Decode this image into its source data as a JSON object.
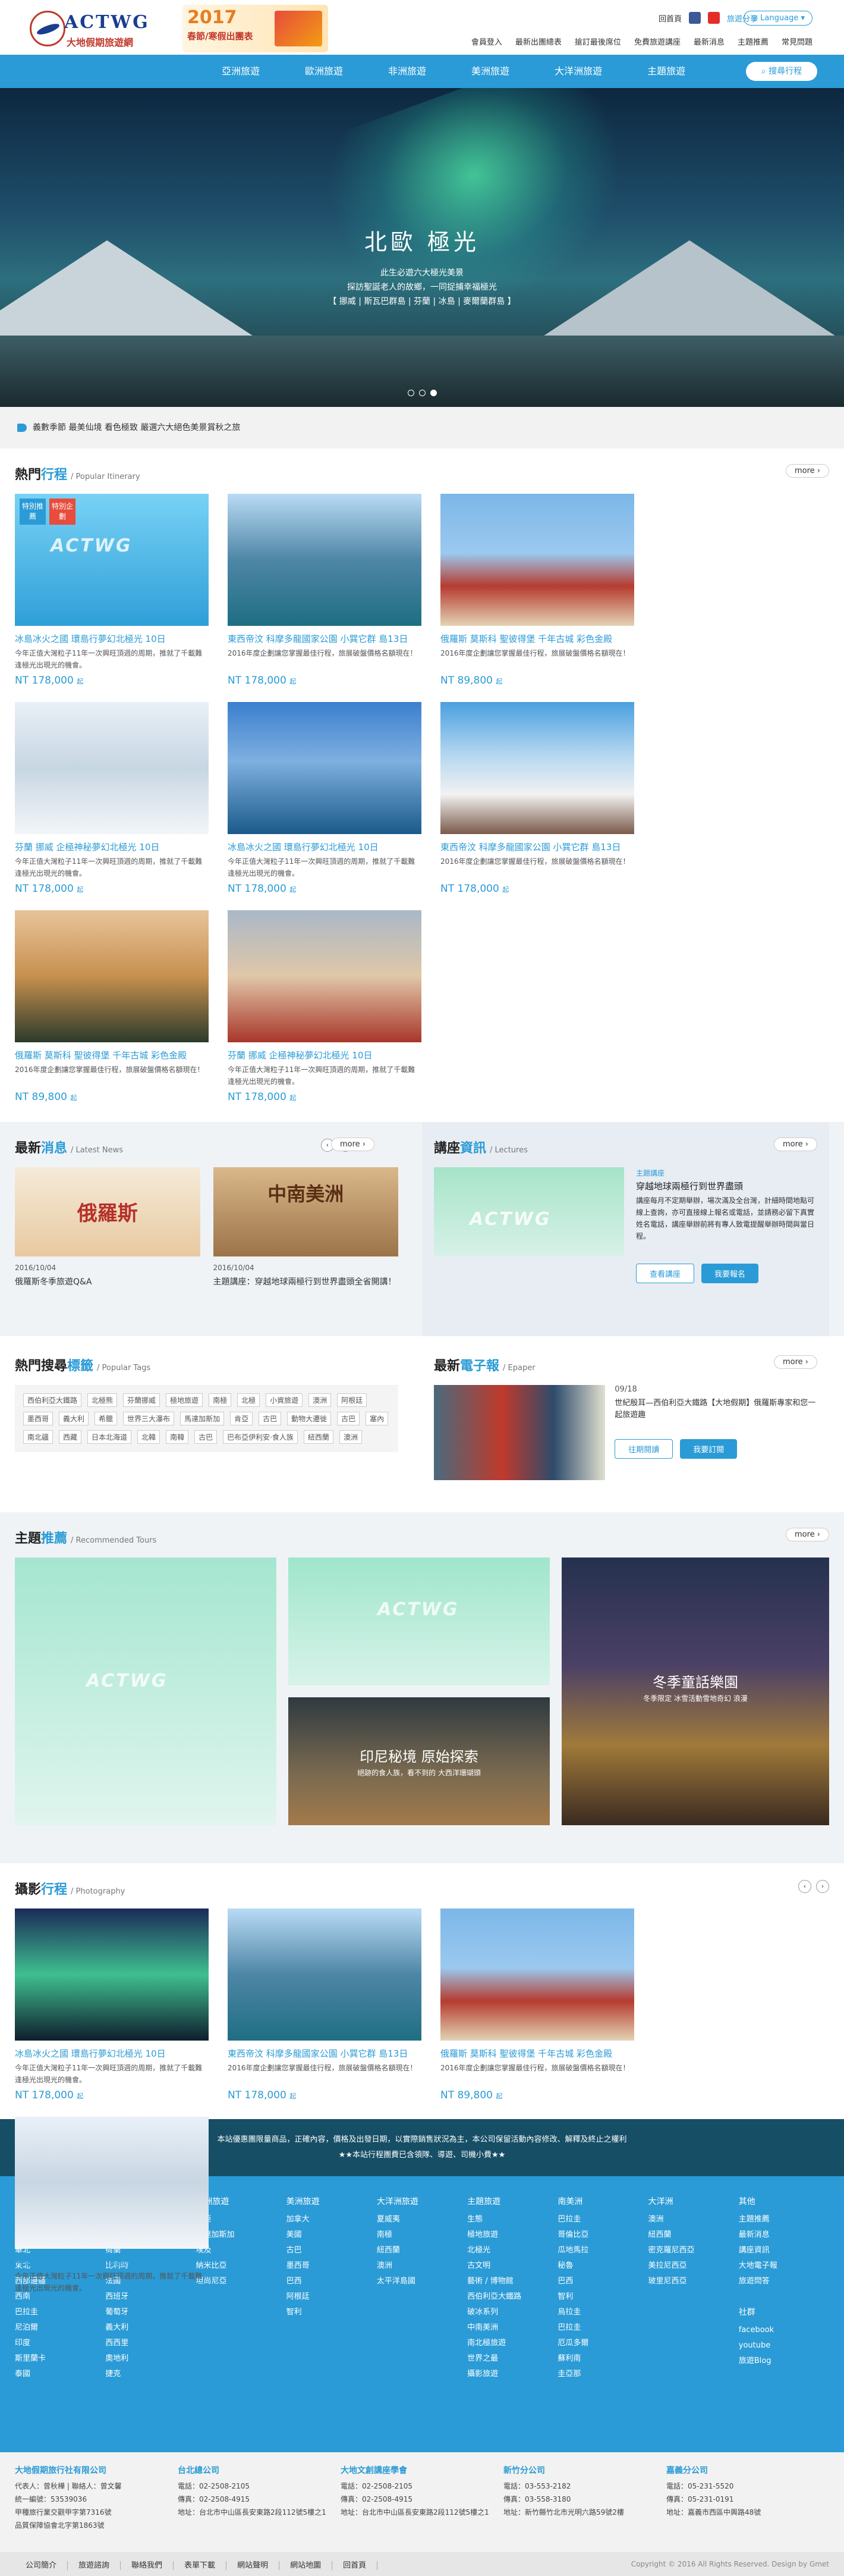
{
  "header": {
    "brand": "ACTWG",
    "brand_sub": "大地假期旅遊網",
    "promo_year": "2017",
    "promo_text": "春節/寒假出團表",
    "social": [
      "回首頁",
      "旅遊分享"
    ],
    "language": "Language",
    "toplinks": [
      "會員登入",
      "最新出團總表",
      "搶訂最後席位",
      "免費旅遊講座",
      "最新消息",
      "主題推薦",
      "常見問題"
    ]
  },
  "nav": {
    "items": [
      "亞洲旅遊",
      "歐洲旅遊",
      "非洲旅遊",
      "美洲旅遊",
      "大洋洲旅遊",
      "主題旅遊"
    ],
    "search": "搜尋行程"
  },
  "hero": {
    "title": "北歐 極光",
    "lines": [
      "此生必遊六大極光美景",
      "探訪聖誕老人的故鄉，一同捉捕幸福極光",
      "【 挪威 | 斯瓦巴群島 | 芬蘭 | 冰島 | 麥爾蘭群島 】"
    ]
  },
  "notice": "義數季節 最美仙境 看色極致 嚴選六大絕色美景賞秋之旅",
  "popular": {
    "title_a": "熱門",
    "title_b": "行程",
    "en": "/ Popular Itinerary",
    "more": "more",
    "badges": [
      "特別推薦",
      "特別企劃"
    ],
    "cards": [
      {
        "title": "冰島冰火之國 環島行夢幻北極光 10日",
        "desc": "今年正值大灣粒子11年一次興旺頂週的周期，推就了千載難逢極光出現光的機會。",
        "price": "NT 178,000",
        "unit": "起"
      },
      {
        "title": "東西帝汶 科摩多龍國家公園 小巽它群 島13日",
        "desc": "2016年度企劃讓您掌握最佳行程，旅展破盤價格名額現在！",
        "price": "NT 178,000",
        "unit": "起"
      },
      {
        "title": "俄羅斯 莫斯科 聖彼得堡 千年古城 彩色金殿",
        "desc": "2016年度企劃讓您掌握最佳行程，旅展破盤價格名額現在！",
        "price": "NT 89,800",
        "unit": "起"
      },
      {
        "title": "芬蘭 挪威 企極神秘夢幻北極光 10日",
        "desc": "今年正值大灣粒子11年一次興旺頂週的周期，推就了千載難逢極光出現光的機會。",
        "price": "NT 178,000",
        "unit": "起"
      },
      {
        "title": "冰島冰火之國 環島行夢幻北極光 10日",
        "desc": "今年正值大灣粒子11年一次興旺頂週的周期，推就了千載難逢極光出現光的機會。",
        "price": "NT 178,000",
        "unit": "起"
      },
      {
        "title": "東西帝汶 科摩多龍國家公園 小巽它群 島13日",
        "desc": "2016年度企劃讓您掌握最佳行程，旅展破盤價格名額現在！",
        "price": "NT 178,000",
        "unit": "起"
      },
      {
        "title": "俄羅斯 莫斯科 聖彼得堡 千年古城 彩色金殿",
        "desc": "2016年度企劃讓您掌握最佳行程，旅展破盤價格名額現在！",
        "price": "NT 89,800",
        "unit": "起"
      },
      {
        "title": "芬蘭 挪威 企極神秘夢幻北極光 10日",
        "desc": "今年正值大灣粒子11年一次興旺頂週的周期，推就了千載難逢極光出現光的機會。",
        "price": "NT 178,000",
        "unit": "起"
      }
    ]
  },
  "news": {
    "title_a": "最新",
    "title_b": "消息",
    "en": "/ Latest News",
    "more": "more",
    "items": [
      {
        "date": "2016/10/04",
        "title": "俄羅斯冬季旅遊Q&A",
        "img_text": "俄羅斯"
      },
      {
        "date": "2016/10/04",
        "title": "主題講座：穿越地球兩極行到世界盡頭全省開講！",
        "img_text": "中南美洲"
      }
    ]
  },
  "lecture": {
    "title_a": "講座",
    "title_b": "資訊",
    "en": "/ Lectures",
    "more": "more",
    "tag": "主題講座",
    "name": "穿越地球兩極行到世界盡頭",
    "desc": "講座每月不定期舉辦，場次滿及全台灣，計細時間地點可線上查詢，亦可直接線上報名或電話，並請務必留下真實姓名電話，講座舉辦前將有專人致電提醒舉辦時間與當日程。",
    "btn_view": "查看講座",
    "btn_join": "我要報名"
  },
  "tags": {
    "title_a": "熱門搜尋",
    "title_b": "標籤",
    "en": "/ Popular Tags",
    "items": [
      "西伯利亞大鐵路",
      "北極熊",
      "芬蘭挪威",
      "極地旅遊",
      "南極",
      "北極",
      "小資旅遊",
      "澳洲",
      "阿根廷",
      "墨西哥",
      "義大利",
      "希臘",
      "世界三大瀑布",
      "馬達加斯加",
      "肯亞",
      "古巴",
      "動物大遷徙",
      "古巴",
      "塞內",
      "南北疆",
      "西藏",
      "日本北海道",
      "北韓",
      "南韓",
      "古巴",
      "巴布亞伊利安·食人族",
      "紐西蘭",
      "澳洲"
    ]
  },
  "epaper": {
    "title_a": "最新",
    "title_b": "電子報",
    "en": "/ Epaper",
    "more": "more",
    "date": "09/18",
    "text": "世紀殷耳—西伯利亞大鐵路【大地假期】俄羅斯專家和您一起旅遊趣",
    "btn_view": "往期閱讀",
    "btn_sub": "我要訂閱"
  },
  "recommend": {
    "title_a": "主題",
    "title_b": "推薦",
    "en": "/ Recommended Tours",
    "more": "more",
    "boxes": [
      {
        "title": "印尼秘境 原始探索",
        "sub": "絕跡的食人族，看不到的 大西洋珊瑚頭"
      },
      {
        "title": "冬季童話樂園",
        "sub": "冬季限定 冰雪活動雪地奇幻 浪漫"
      }
    ]
  },
  "photo": {
    "title_a": "攝影",
    "title_b": "行程",
    "en": "/ Photography",
    "cards": [
      {
        "title": "冰島冰火之國 環島行夢幻北極光 10日",
        "desc": "今年正值大灣粒子11年一次興旺頂週的周期，推就了千載難逢極光出現光的機會。",
        "price": "NT 178,000",
        "unit": "起"
      },
      {
        "title": "東西帝汶 科摩多龍國家公園 小巽它群 島13日",
        "desc": "2016年度企劃讓您掌握最佳行程，旅展破盤價格名額現在！",
        "price": "NT 178,000",
        "unit": "起"
      },
      {
        "title": "俄羅斯 莫斯科 聖彼得堡 千年古城 彩色金殿",
        "desc": "2016年度企劃讓您掌握最佳行程，旅展破盤價格名額現在！",
        "price": "NT 89,800",
        "unit": "起"
      },
      {
        "title": "芬蘭 挪威 企極神秘夢幻北極光 10日",
        "desc": "今年正值大灣粒子11年一次興旺頂週的周期，推就了千載難逢極光出現光的機會。",
        "price": "NT 178,000",
        "unit": "起"
      }
    ]
  },
  "disclaimer": [
    "本站優惠團限量商品，正確內容，價格及出發日期，以實際銷售狀況為主，本公司保留活動內容修改、解釋及終止之權利",
    "★★本站行程團費已含領隊、導遊、司機小費★★"
  ],
  "footer": {
    "cols": [
      {
        "h": "亞洲旅遊",
        "items": [
          "韓國",
          "東南",
          "華北",
          "東北",
          "西部邊疆",
          "西南",
          "巴拉圭",
          "尼泊爾",
          "印度",
          "斯里蘭卡",
          "泰國"
        ]
      },
      {
        "h": "歐洲旅遊",
        "items": [
          "英國",
          "德國",
          "荷蘭",
          "比利時",
          "法國",
          "西班牙",
          "葡萄牙",
          "義大利",
          "西西里",
          "奧地利",
          "捷克"
        ]
      },
      {
        "h": "非洲旅遊",
        "items": [
          "肯亞",
          "馬達加斯加",
          "埃及",
          "納米比亞",
          "坦尚尼亞"
        ]
      },
      {
        "h": "美洲旅遊",
        "items": [
          "加拿大",
          "美國",
          "古巴",
          "墨西哥",
          "巴西",
          "阿根廷",
          "智利"
        ]
      },
      {
        "h": "大洋洲旅遊",
        "items": [
          "夏威夷",
          "南極",
          "紐西蘭",
          "澳洲",
          "太平洋島國"
        ]
      },
      {
        "h": "主題旅遊",
        "items": [
          "生態",
          "極地旅遊",
          "北極光",
          "古文明",
          "藝術 / 博物館",
          "西伯利亞大鐵路",
          "破冰系列",
          "中南美洲",
          "南北極旅遊",
          "世界之最",
          "攝影旅遊"
        ]
      },
      {
        "h": "南美洲",
        "items": [
          "巴拉圭",
          "哥倫比亞",
          "瓜地馬拉",
          "秘魯",
          "巴西",
          "智利",
          "烏拉圭",
          "巴拉圭",
          "厄瓜多爾",
          "蘇利南",
          "圭亞那"
        ]
      },
      {
        "h": "大洋洲",
        "items": [
          "澳洲",
          "紐西蘭",
          "密克羅尼西亞",
          "美拉尼西亞",
          "玻里尼西亞"
        ]
      },
      {
        "h": "其他",
        "items": [
          "主題推薦",
          "最新消息",
          "講座資訊",
          "大地電子報",
          "旅遊問答"
        ],
        "social_h": "社群",
        "social": [
          "facebook",
          "youtube",
          "旅遊Blog"
        ]
      }
    ],
    "offices": [
      {
        "h": "大地假期旅行社有限公司",
        "lines": [
          "代表人：曾秋樺 | 聯絡人：曾文馨",
          "統一編號：53539036",
          "甲種旅行業交觀甲字第7316號",
          "品質保障協會北字第1863號"
        ]
      },
      {
        "h": "台北總公司",
        "lines": [
          "電話：02-2508-2105",
          "傳真：02-2508-4915",
          "地址：台北市中山區長安東路2段112號5樓之1"
        ]
      },
      {
        "h": "大地文創講座學會",
        "lines": [
          "電話：02-2508-2105",
          "傳真：02-2508-4915",
          "地址：台北市中山區長安東路2段112號5樓之1"
        ]
      },
      {
        "h": "新竹分公司",
        "lines": [
          "電話：03-553-2182",
          "傳真：03-558-3180",
          "地址：新竹縣竹北市光明六路59號2樓"
        ]
      },
      {
        "h": "嘉義分公司",
        "lines": [
          "電話：05-231-5520",
          "傳真：05-231-0191",
          "地址：嘉義市西區中興路48號"
        ]
      }
    ],
    "bottom_links": [
      "公司簡介",
      "旅遊諮詢",
      "聯絡我們",
      "表單下載",
      "網站聲明",
      "網站地圖",
      "回首頁"
    ],
    "copyright": "Copyright © 2016 All Rights Reserved. Design by Gmet"
  }
}
